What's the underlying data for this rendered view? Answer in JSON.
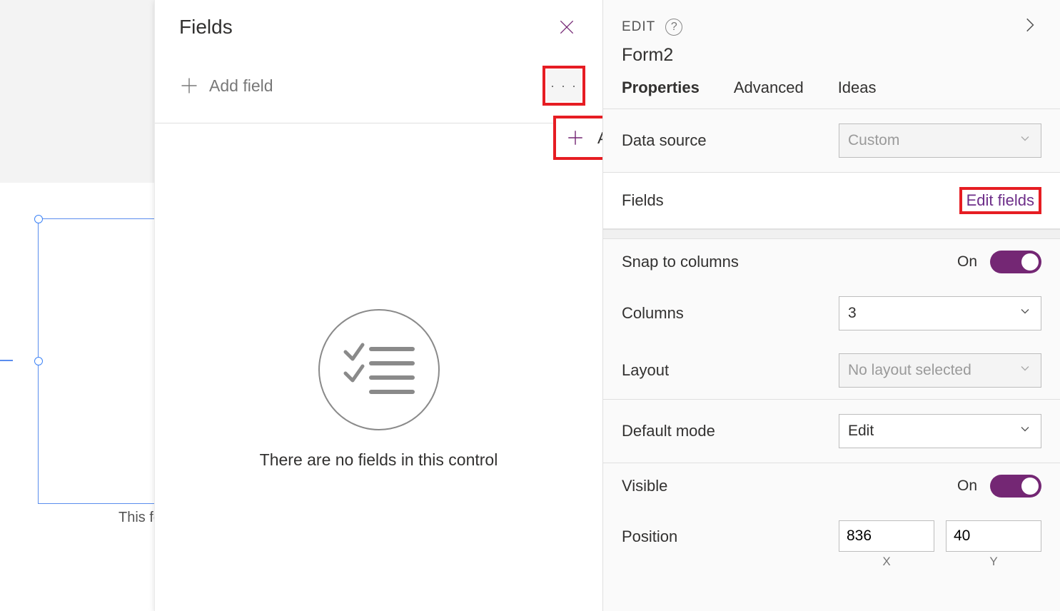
{
  "canvas": {
    "caption_truncated": "This fo"
  },
  "fieldsPanel": {
    "title": "Fields",
    "addFieldLabel": "Add field",
    "emptyText": "There are no fields in this control"
  },
  "flyout": {
    "addCustomCardLabel": "Add a custom card"
  },
  "rightPanel": {
    "editLabel": "EDIT",
    "controlName": "Form2",
    "tabs": {
      "properties": "Properties",
      "advanced": "Advanced",
      "ideas": "Ideas"
    },
    "props": {
      "dataSource": {
        "label": "Data source",
        "value": "Custom"
      },
      "fields": {
        "label": "Fields",
        "link": "Edit fields"
      },
      "snapToColumns": {
        "label": "Snap to columns",
        "value": "On"
      },
      "columns": {
        "label": "Columns",
        "value": "3"
      },
      "layout": {
        "label": "Layout",
        "value": "No layout selected"
      },
      "defaultMode": {
        "label": "Default mode",
        "value": "Edit"
      },
      "visible": {
        "label": "Visible",
        "value": "On"
      },
      "position": {
        "label": "Position",
        "x": "836",
        "y": "40",
        "xLabel": "X",
        "yLabel": "Y"
      }
    }
  }
}
